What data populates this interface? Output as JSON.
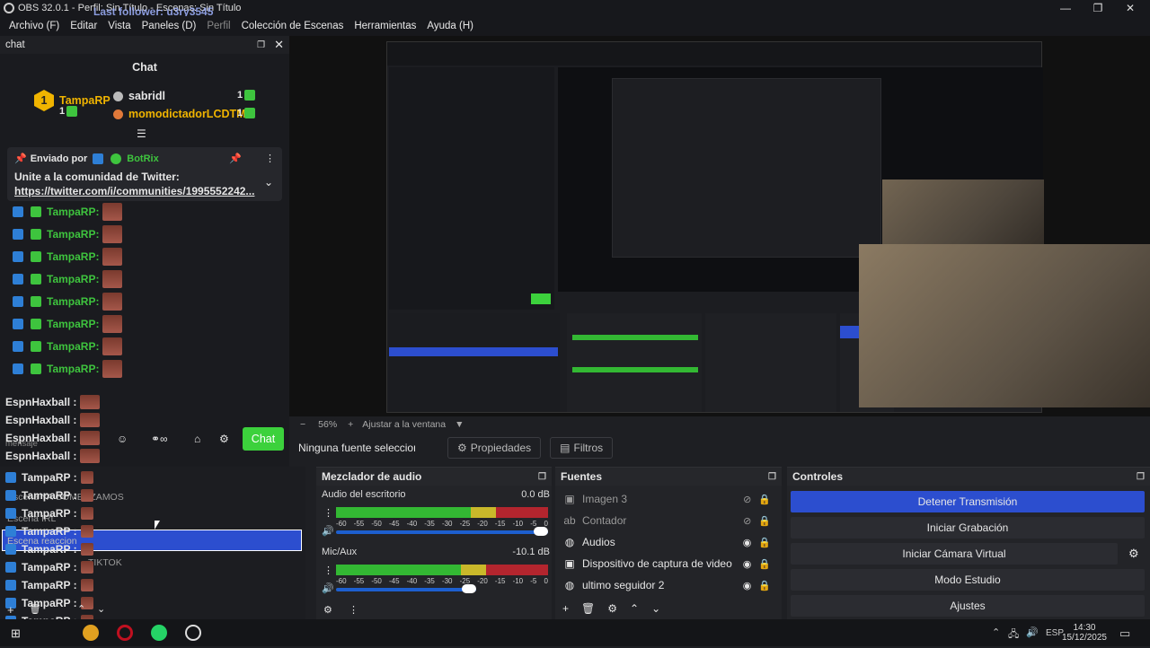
{
  "window": {
    "title": "OBS 32.0.1 - Perfil: Sin Título - Escenas: Sin Título",
    "overlay": "Last follower: u3ry3545",
    "min": "—",
    "max": "❐",
    "close": "✕"
  },
  "menu": [
    "Archivo (F)",
    "Editar",
    "Vista",
    "Paneles (D)",
    "Perfil",
    "Colección de Escenas",
    "Herramientas",
    "Ayuda (H)"
  ],
  "chat": {
    "dock_title": "chat",
    "title": "Chat",
    "top_subs": [
      {
        "name": "TampaRP",
        "count": "1",
        "rank": "1"
      },
      {
        "name": "sabridl",
        "count": "1"
      },
      {
        "name": "momodictadorLCDTM",
        "count": "1"
      }
    ],
    "pinned": {
      "sent_by": "Enviado por",
      "bot": "BotRix",
      "message": "Unite a la comunidad de Twitter:",
      "link": "https://twitter.com/i/communities/1995552242..."
    },
    "messages": [
      "TampaRP:",
      "TampaRP:",
      "TampaRP:",
      "TampaRP:",
      "TampaRP:",
      "TampaRP:",
      "TampaRP:",
      "TampaRP:"
    ],
    "espn": [
      "EspnHaxball :",
      "EspnHaxball :",
      "EspnHaxball :",
      "EspnHaxball :"
    ],
    "input_placeholder": "mensaje",
    "send": "Chat"
  },
  "preview": {
    "zoom": "56%",
    "fit": "Ajustar a la ventana",
    "fit_arrow": "▼"
  },
  "source_bar": {
    "no_source": "Ninguna fuente seleccionada",
    "properties": "Propiedades",
    "filters": "Filtros"
  },
  "scenes": {
    "items": [
      "Escena YA COMENZAMOS",
      "Escena IRL",
      "Escena reaccion",
      "TIKTOK"
    ],
    "overlay_rows": [
      "TampaRP :",
      "TampaRP :",
      "TampaRP :",
      "TampaRP :",
      "TampaRP :",
      "TampaRP :",
      "TampaRP :",
      "TampaRP :",
      "TampaRP :",
      "TampaRP :"
    ]
  },
  "mixer": {
    "title": "Mezclador de audio",
    "channels": [
      {
        "name": "Audio del escritorio",
        "db": "0.0 dB",
        "level": 0.88,
        "volume": 1.0
      },
      {
        "name": "Mic/Aux",
        "db": "-10.1 dB",
        "level": 0.82,
        "volume": 0.66
      }
    ],
    "ticks": [
      "-60",
      "-55",
      "-50",
      "-45",
      "-40",
      "-35",
      "-30",
      "-25",
      "-20",
      "-15",
      "-10",
      "-5",
      "0"
    ]
  },
  "sources": {
    "title": "Fuentes",
    "items": [
      {
        "name": "Imagen 3",
        "icon": "image-icon",
        "glyph": "▣",
        "visible": false
      },
      {
        "name": "Contador",
        "icon": "text-icon",
        "glyph": "ab",
        "visible": false
      },
      {
        "name": "Audios",
        "icon": "browser-icon",
        "glyph": "◍",
        "visible": true
      },
      {
        "name": "Dispositivo de captura de video",
        "icon": "camera-icon",
        "glyph": "▣",
        "visible": true
      },
      {
        "name": "ultimo seguidor 2",
        "icon": "browser-icon",
        "glyph": "◍",
        "visible": true
      }
    ]
  },
  "controls": {
    "title": "Controles",
    "buttons": [
      "Detener Transmisión",
      "Iniciar Grabación",
      "Iniciar Cámara Virtual",
      "Modo Estudio",
      "Ajustes"
    ]
  },
  "taskbar": {
    "lang": "ESP",
    "time": "14:30",
    "date": "15/12/2025"
  },
  "colors": {
    "accent": "#2c4ecf",
    "chat_green": "#3cd13c",
    "meter_green": "#33b833",
    "meter_yellow": "#c9b82a",
    "meter_red": "#b3252e"
  }
}
